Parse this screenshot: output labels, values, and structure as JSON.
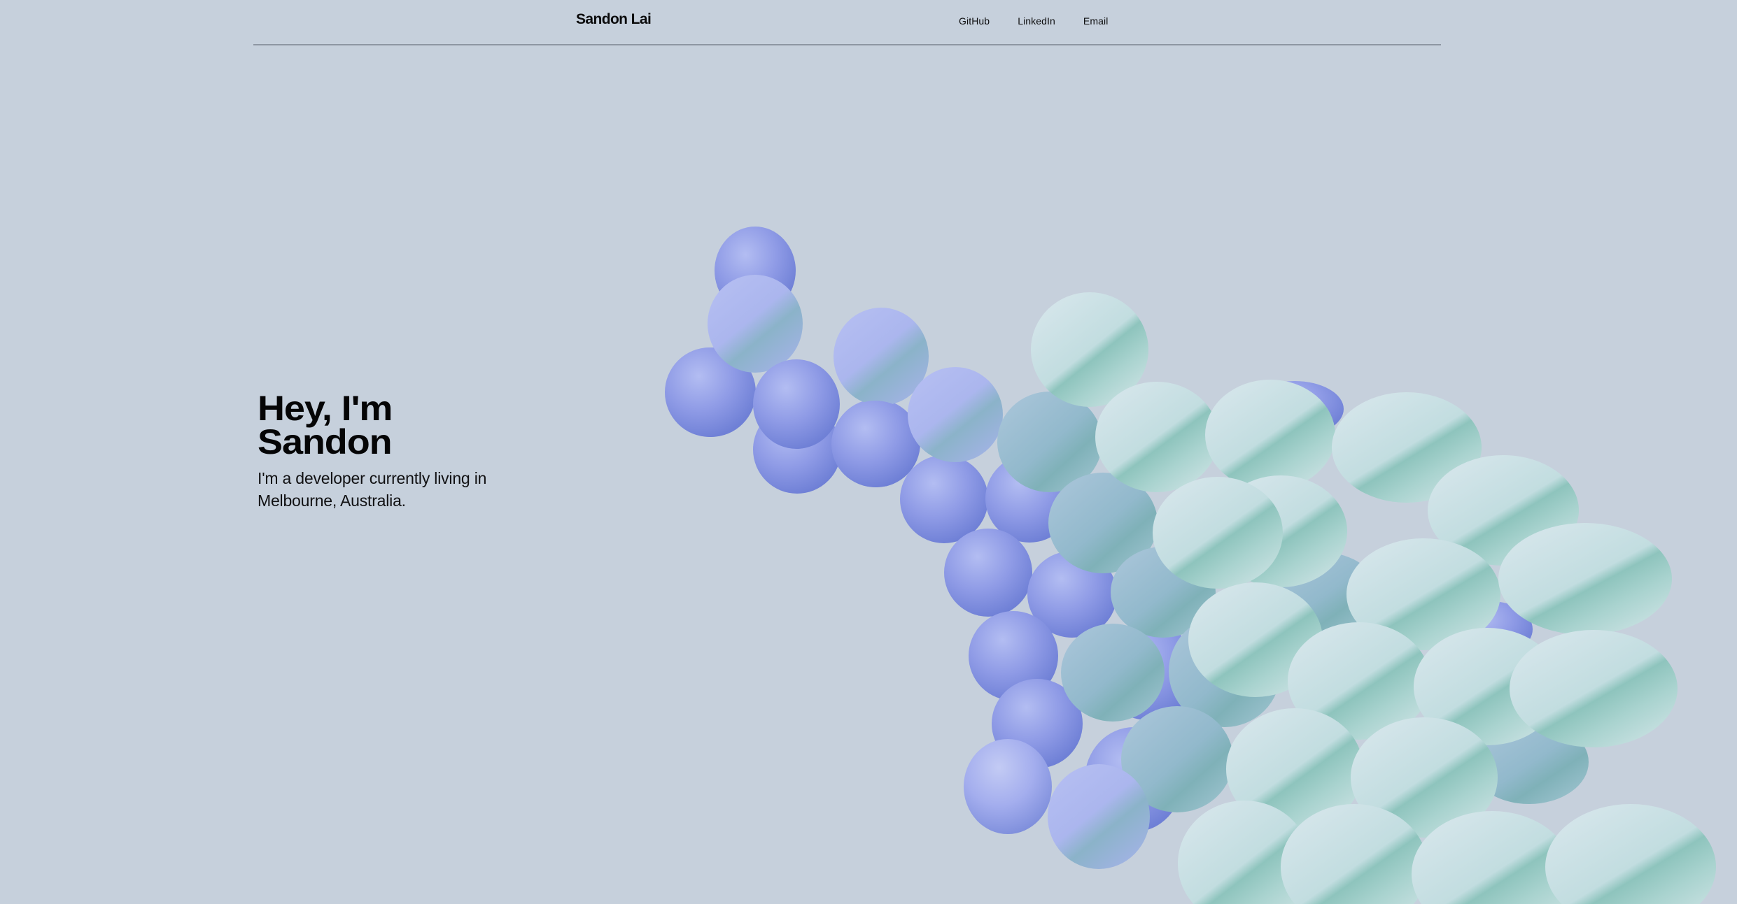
{
  "header": {
    "brand": "Sandon Lai",
    "nav": [
      {
        "label": "GitHub"
      },
      {
        "label": "LinkedIn"
      },
      {
        "label": "Email"
      }
    ]
  },
  "hero": {
    "title_line1": "Hey, I'm",
    "title_line2": "Sandon",
    "subtitle": "I'm a developer currently living in Melbourne, Australia."
  },
  "colors": {
    "background": "#c6d0dc",
    "divider": "#8e97a3",
    "text": "#0b0b0c",
    "sphere_blue": "#8b98e4",
    "sphere_mint": "#b9dcd8"
  },
  "icons": {
    "art": "balloon-sphere-cluster"
  }
}
